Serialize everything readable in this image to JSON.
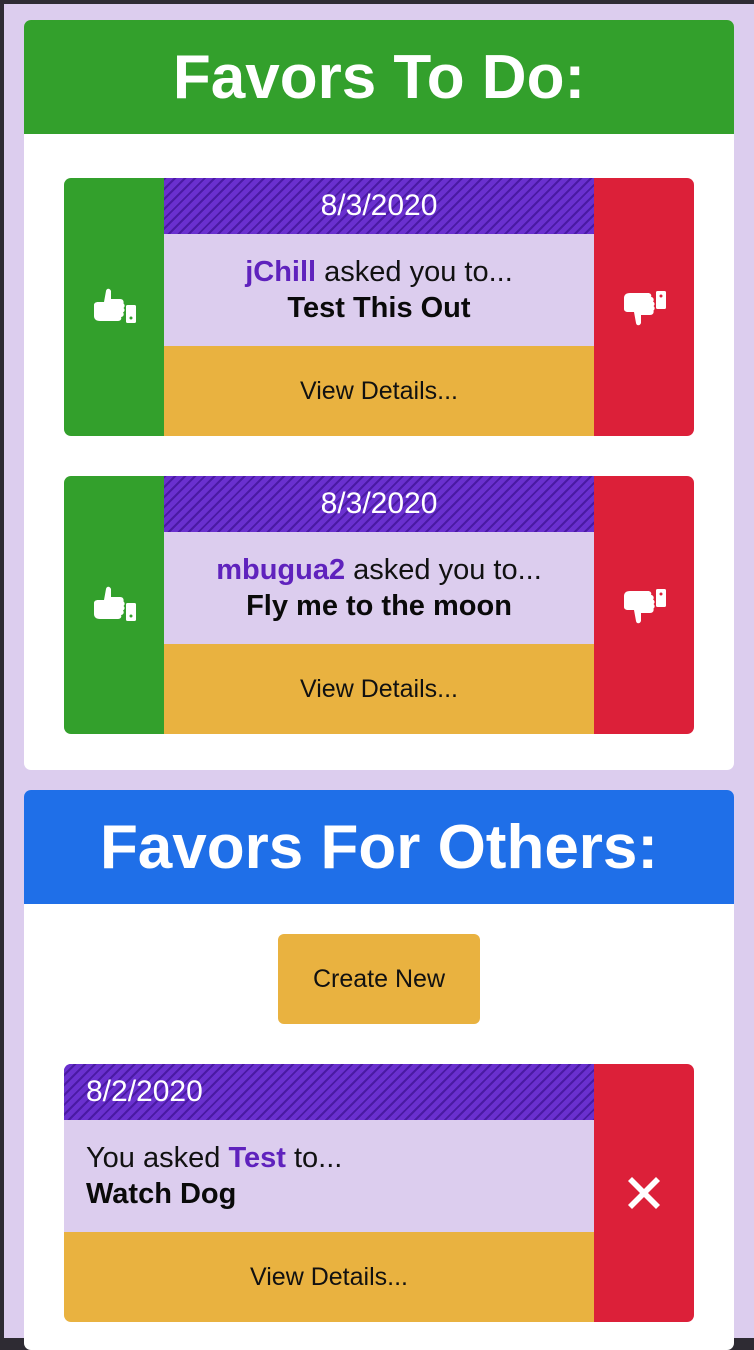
{
  "todo": {
    "title": "Favors To Do:",
    "cards": [
      {
        "date": "8/3/2020",
        "requester": "jChill",
        "asked_text": " asked you to...",
        "task": "Test This Out",
        "details_label": "View Details..."
      },
      {
        "date": "8/3/2020",
        "requester": "mbugua2",
        "asked_text": " asked you to...",
        "task": "Fly me to the moon",
        "details_label": "View Details..."
      }
    ]
  },
  "others": {
    "title": "Favors For Others:",
    "create_label": "Create New",
    "cards": [
      {
        "date": "8/2/2020",
        "prefix": "You asked ",
        "target": "Test",
        "suffix": " to...",
        "task": "Watch Dog",
        "details_label": "View Details..."
      }
    ]
  },
  "icons": {
    "accept": "thumbs-up-icon",
    "reject": "thumbs-down-icon",
    "delete": "close-icon"
  },
  "colors": {
    "page_bg": "#dccdee",
    "todo_header": "#33a02c",
    "others_header": "#1f6fe8",
    "accept": "#33a02c",
    "reject": "#dc2039",
    "date_bar": "#5a21bd",
    "details": "#e9b240",
    "name": "#5f22bd"
  }
}
